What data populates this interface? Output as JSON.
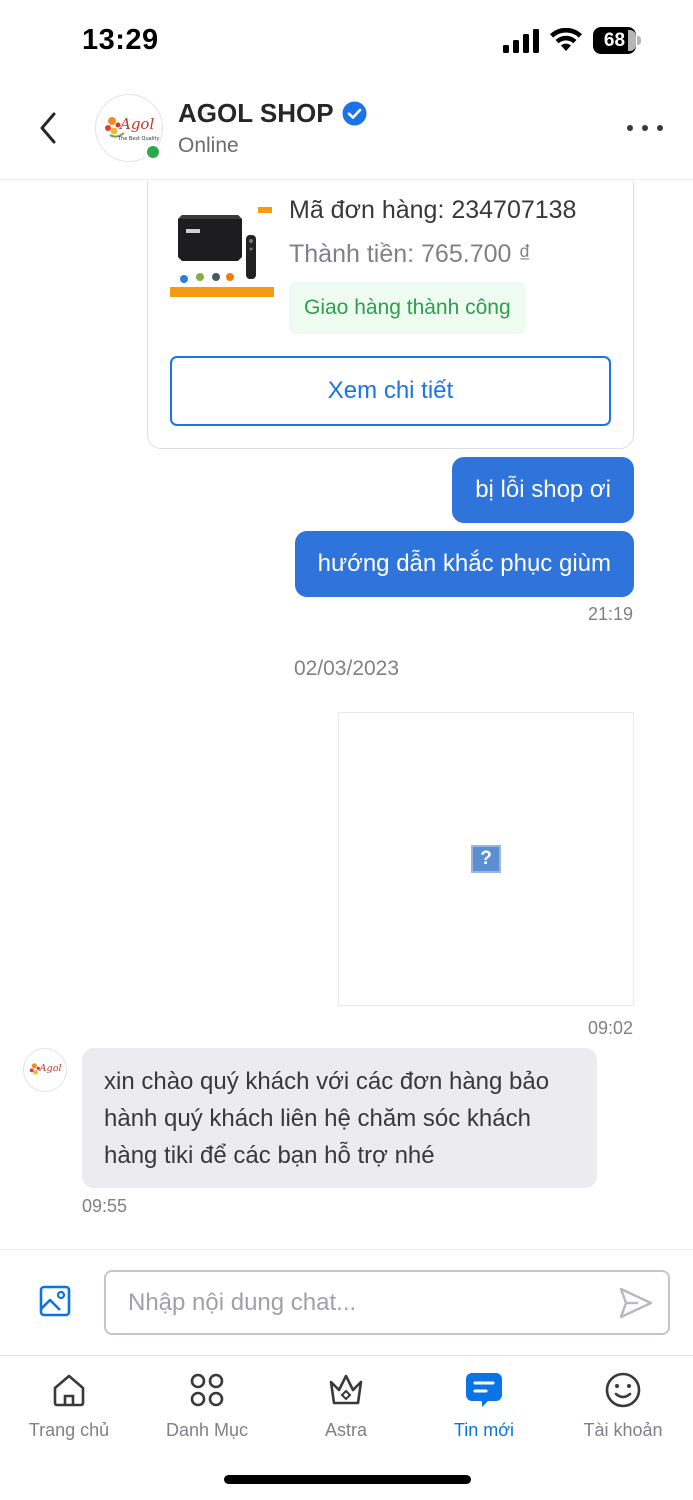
{
  "status_bar": {
    "time": "13:29",
    "battery": "68"
  },
  "header": {
    "shop_name": "AGOL SHOP",
    "shop_status": "Online",
    "avatar_logo_text": "Agol",
    "avatar_tagline": "The Best Quality"
  },
  "order_card": {
    "order_id": "Mã đơn hàng: 234707138",
    "total": "Thành tiền: 765.700 ₫",
    "status": "Giao hàng thành công",
    "detail_button": "Xem chi tiết"
  },
  "messages": [
    {
      "direction": "out",
      "text": "bị lỗi shop ơi"
    },
    {
      "direction": "out",
      "text": "hướng dẫn khắc phục giùm",
      "time": "21:19"
    },
    {
      "type": "date",
      "text": "02/03/2023"
    },
    {
      "direction": "out",
      "type": "image",
      "broken_glyph": "?",
      "time": "09:02"
    },
    {
      "direction": "in",
      "text": "xin chào quý khách với các đơn hàng bảo hành quý khách liên hệ chăm sóc khách hàng tiki để các bạn hỗ trợ nhé",
      "time": "09:55"
    }
  ],
  "input": {
    "placeholder": "Nhập nội dung chat..."
  },
  "bottom_nav": [
    {
      "label": "Trang chủ",
      "icon": "home-icon",
      "active": false
    },
    {
      "label": "Danh Mục",
      "icon": "grid-icon",
      "active": false
    },
    {
      "label": "Astra",
      "icon": "crown-icon",
      "active": false
    },
    {
      "label": "Tin mới",
      "icon": "chat-icon",
      "active": true
    },
    {
      "label": "Tài khoản",
      "icon": "smiley-icon",
      "active": false
    }
  ],
  "colors": {
    "primary_blue": "#0b74e5",
    "bubble_out": "#2e74da",
    "bubble_in": "#ebebf0",
    "success_green": "#2e9e4a",
    "online_green": "#2ea84b"
  }
}
